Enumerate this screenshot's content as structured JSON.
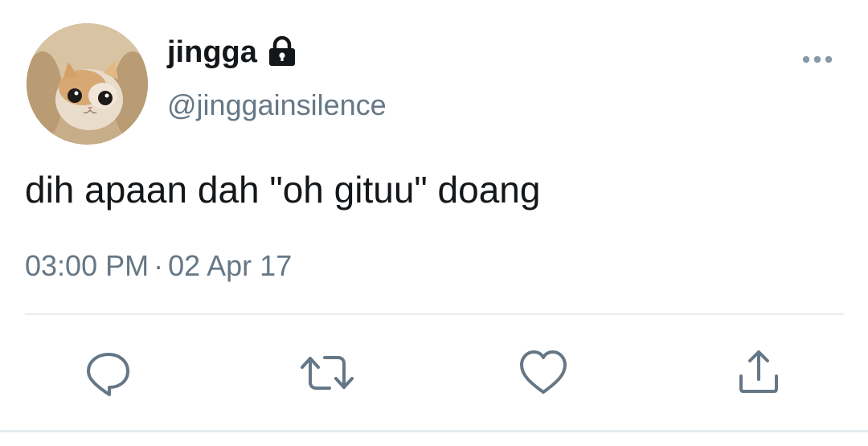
{
  "user": {
    "display_name": "jingga",
    "handle": "@jinggainsilence",
    "protected": true
  },
  "tweet": {
    "text": "dih apaan dah \"oh gituu\" doang",
    "time": "03:00 PM",
    "separator": "·",
    "date": "02 Apr 17"
  },
  "icons": {
    "avatar": "kitten-photo",
    "lock": "lock-icon",
    "more": "more-dots-icon",
    "reply": "reply-icon",
    "retweet": "retweet-icon",
    "like": "heart-icon",
    "share": "share-icon"
  },
  "colors": {
    "text": "#14171a",
    "secondary": "#657786",
    "divider": "#e6ecf0"
  }
}
